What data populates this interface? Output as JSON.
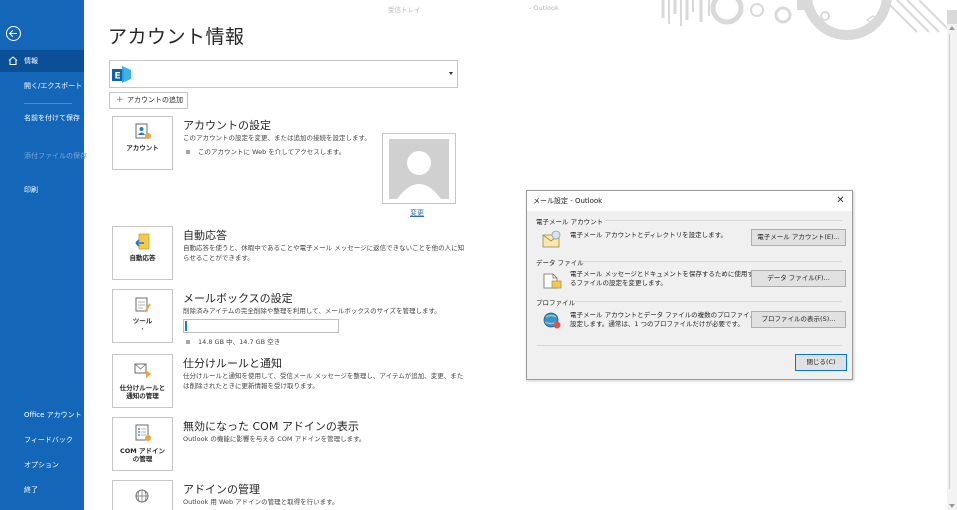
{
  "window": {
    "title_folder": "受信トレイ",
    "title_app": "- Outlook"
  },
  "sidebar": {
    "items": [
      {
        "label": "情報",
        "active": true
      },
      {
        "label": "開く/エクスポート"
      },
      {
        "label": "名前を付けて保存"
      },
      {
        "label": "添付ファイルの保存",
        "disabled": true
      },
      {
        "label": "印刷"
      },
      {
        "label": "Office アカウント"
      },
      {
        "label": "フィードバック"
      },
      {
        "label": "オプション"
      },
      {
        "label": "終了"
      }
    ]
  },
  "page": {
    "title": "アカウント情報",
    "add_account": "アカウントの追加",
    "change_photo": "変更"
  },
  "sections": [
    {
      "tile_label": "アカウント\n設定 ·",
      "title": "アカウントの設定",
      "desc": "このアカウントの設定を変更、または追加の接続を設定します。",
      "bullet": "このアカウントに Web を介してアクセスします。"
    },
    {
      "tile_label": "自動応答",
      "title": "自動応答",
      "desc": "自動応答を使うと、休暇中であることや電子メール メッセージに返信できないことを他の人に知\nらせることができます。"
    },
    {
      "tile_label": "ツール\n·",
      "title": "メールボックスの設定",
      "desc": "削除済みアイテムの完全削除や整理を利用して、メールボックスのサイズを管理します。",
      "bullet": "14.8 GB 中、14.7 GB 空き",
      "usage_fraction": 0.007
    },
    {
      "tile_label": "仕分けルールと\n通知の管理",
      "title": "仕分けルールと通知",
      "desc": "仕分けルールと通知を使用して、受信メール メッセージを整理し、アイテムが追加、変更、また\nは削除されたときに更新情報を受け取ります。"
    },
    {
      "tile_label": "COM アドイン\nの管理",
      "title": "無効になった COM アドインの表示",
      "desc": "Outlook の機能に影響を与える COM アドインを管理します。"
    },
    {
      "tile_label": "",
      "title": "アドインの管理",
      "desc": "Outlook 用 Web アドインの管理と取得を行います。"
    }
  ],
  "dialog": {
    "title": "メール設定 - Outlook",
    "groups": [
      {
        "title": "電子メール アカウント",
        "desc": "電子メール アカウントとディレクトリを設定します。",
        "button": "電子メール アカウント(E)..."
      },
      {
        "title": "データ ファイル",
        "desc": "電子メール メッセージとドキュメントを保存するために使用す\nるファイルの設定を変更します。",
        "button": "データ ファイル(F)..."
      },
      {
        "title": "プロファイル",
        "desc": "電子メール アカウントとデータ ファイルの複数のプロファイルを\n設定します。通常は、1 つのプロファイルだけが必要です。",
        "button": "プロファイルの表示(S)..."
      }
    ],
    "close_button": "閉じる(C)"
  },
  "colors": {
    "sidebar": "#1467b8",
    "sidebar_active": "#0b4f96",
    "accent": "#1e7bc8",
    "link": "#2b6cb3"
  }
}
